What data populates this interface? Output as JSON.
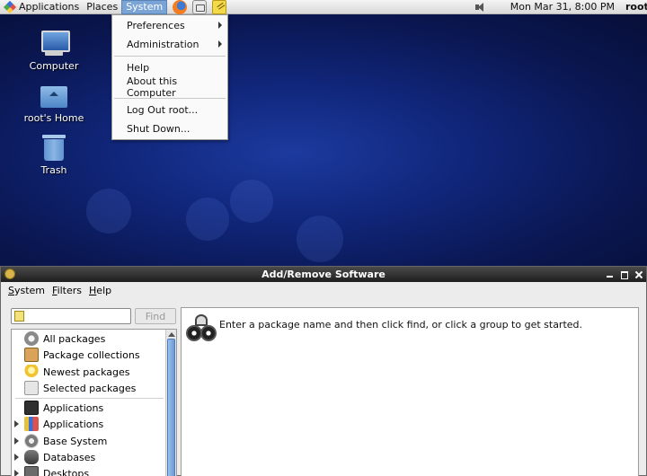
{
  "top_panel": {
    "menus": [
      "Applications",
      "Places",
      "System"
    ],
    "launchers": [
      "firefox-icon",
      "mail-client-icon",
      "notes-icon"
    ],
    "clock": "Mon Mar 31,  8:00 PM",
    "user": "root"
  },
  "system_menu": {
    "items": [
      "Preferences",
      "Administration",
      "Help",
      "About this Computer",
      "Log Out root...",
      "Shut Down..."
    ]
  },
  "desktop_icons": [
    "Computer",
    "root's Home",
    "Trash"
  ],
  "window": {
    "title": "Add/Remove Software",
    "menubar": [
      {
        "underlined": "S",
        "rest": "ystem"
      },
      {
        "underlined": "F",
        "rest": "ilters"
      },
      {
        "underlined": "H",
        "rest": "elp"
      }
    ],
    "search": {
      "value": "",
      "placeholder": ""
    },
    "find_label": "Find",
    "hint": "Enter a package name and then click find, or click a group to get started.",
    "categories": [
      "All packages",
      "Package collections",
      "Newest packages",
      "Selected packages"
    ],
    "groups": [
      "Applications",
      "Applications",
      "Base System",
      "Databases",
      "Desktops"
    ]
  },
  "colors": {
    "desktop_background": "#0d1d5c",
    "active_menu": "#7aa4d6",
    "titlebar": "#2a2a2a"
  }
}
